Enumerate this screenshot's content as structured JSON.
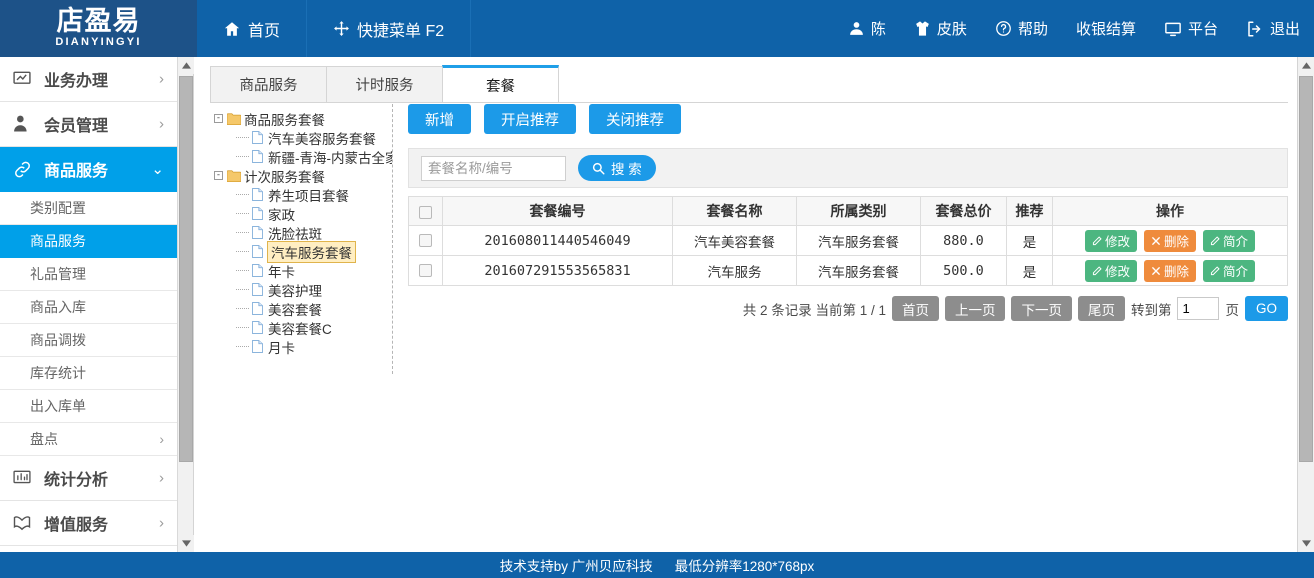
{
  "header": {
    "logo_cn": "店盈易",
    "logo_en": "DIANYINGYI",
    "nav": [
      {
        "icon": "home-icon",
        "label": "首页"
      },
      {
        "icon": "move-icon",
        "label": "快捷菜单 F2"
      }
    ],
    "right": [
      {
        "icon": "user-icon",
        "label": "陈"
      },
      {
        "icon": "shirt-icon",
        "label": "皮肤"
      },
      {
        "icon": "question-icon",
        "label": "帮助"
      },
      {
        "icon": "",
        "label": "收银结算"
      },
      {
        "icon": "monitor-icon",
        "label": "平台"
      },
      {
        "icon": "logout-icon",
        "label": "退出"
      }
    ]
  },
  "sidebar": {
    "items": [
      {
        "label": "业务办理",
        "icon": "board-icon",
        "type": "top",
        "arrow": "›",
        "active": false
      },
      {
        "label": "会员管理",
        "icon": "member-icon",
        "type": "top",
        "arrow": "›",
        "active": false
      },
      {
        "label": "商品服务",
        "icon": "link-icon",
        "type": "top",
        "arrow": "⌄",
        "active": true
      },
      {
        "label": "类别配置",
        "type": "sub",
        "active": false
      },
      {
        "label": "商品服务",
        "type": "sub",
        "active": true
      },
      {
        "label": "礼品管理",
        "type": "sub",
        "active": false
      },
      {
        "label": "商品入库",
        "type": "sub",
        "active": false
      },
      {
        "label": "商品调拨",
        "type": "sub",
        "active": false
      },
      {
        "label": "库存统计",
        "type": "sub",
        "active": false
      },
      {
        "label": "出入库单",
        "type": "sub",
        "active": false
      },
      {
        "label": "盘点",
        "type": "sub",
        "arrow": "›",
        "active": false
      },
      {
        "label": "统计分析",
        "icon": "chart-icon",
        "type": "top",
        "arrow": "›",
        "active": false
      },
      {
        "label": "增值服务",
        "icon": "gift-icon",
        "type": "top",
        "arrow": "›",
        "active": false
      }
    ]
  },
  "tabs": [
    {
      "label": "商品服务",
      "active": false
    },
    {
      "label": "计时服务",
      "active": false
    },
    {
      "label": "套餐",
      "active": true
    }
  ],
  "tree": [
    {
      "level": 1,
      "label": "商品服务套餐",
      "icon": "folder-icon",
      "toggle": "-",
      "selected": false
    },
    {
      "level": 2,
      "label": "汽车美容服务套餐",
      "icon": "file-icon",
      "selected": false
    },
    {
      "level": 2,
      "label": "新疆-青海-内蒙古全家",
      "icon": "file-icon",
      "selected": false
    },
    {
      "level": 1,
      "label": "计次服务套餐",
      "icon": "folder-icon",
      "toggle": "-",
      "selected": false
    },
    {
      "level": 2,
      "label": "养生项目套餐",
      "icon": "file-icon",
      "selected": false
    },
    {
      "level": 2,
      "label": "家政",
      "icon": "file-icon",
      "selected": false
    },
    {
      "level": 2,
      "label": "洗脸祛斑",
      "icon": "file-icon",
      "selected": false
    },
    {
      "level": 2,
      "label": "汽车服务套餐",
      "icon": "file-icon",
      "selected": true
    },
    {
      "level": 2,
      "label": "年卡",
      "icon": "file-icon",
      "selected": false
    },
    {
      "level": 2,
      "label": "美容护理",
      "icon": "file-icon",
      "selected": false
    },
    {
      "level": 2,
      "label": "美容套餐",
      "icon": "file-icon",
      "selected": false
    },
    {
      "level": 2,
      "label": "美容套餐C",
      "icon": "file-icon",
      "selected": false
    },
    {
      "level": 2,
      "label": "月卡",
      "icon": "file-icon",
      "selected": false
    }
  ],
  "toolbar": {
    "add_label": "新增",
    "enable_recommend_label": "开启推荐",
    "disable_recommend_label": "关闭推荐"
  },
  "search": {
    "placeholder": "套餐名称/编号",
    "value": "",
    "button_label": "搜 索",
    "button_icon": "search-icon"
  },
  "table": {
    "columns": [
      "",
      "套餐编号",
      "套餐名称",
      "所属类别",
      "套餐总价",
      "推荐",
      "操作"
    ],
    "rows": [
      {
        "code": "201608011440546049",
        "name": "汽车美容套餐",
        "category": "汽车服务套餐",
        "price": "880.0",
        "recommend": "是",
        "actions": [
          {
            "label": "修改",
            "icon": "edit-icon",
            "style": "green"
          },
          {
            "label": "删除",
            "icon": "close-icon",
            "style": "orange"
          },
          {
            "label": "简介",
            "icon": "edit-icon",
            "style": "green"
          }
        ]
      },
      {
        "code": "201607291553565831",
        "name": "汽车服务",
        "category": "汽车服务套餐",
        "price": "500.0",
        "recommend": "是",
        "actions": [
          {
            "label": "修改",
            "icon": "edit-icon",
            "style": "green"
          },
          {
            "label": "删除",
            "icon": "close-icon",
            "style": "orange"
          },
          {
            "label": "简介",
            "icon": "edit-icon",
            "style": "green"
          }
        ]
      }
    ]
  },
  "pager": {
    "summary": "共 2 条记录 当前第 1 / 1",
    "first": "首页",
    "prev": "上一页",
    "next": "下一页",
    "last": "尾页",
    "goto_prefix": "转到第",
    "goto_value": "1",
    "goto_suffix": "页",
    "go": "GO"
  },
  "footer": {
    "support": "技术支持by 广州贝应科技",
    "resolution": "最低分辨率1280*768px"
  },
  "colors": {
    "header_blue": "#0f62a8",
    "logo_blue": "#1d5288",
    "accent_blue": "#00a0e9",
    "button_blue": "#1c9ae8",
    "green": "#4cb680",
    "orange": "#ef8b3c",
    "pager_gray": "#8d8d8d",
    "tree_select": "#ffeec2"
  }
}
